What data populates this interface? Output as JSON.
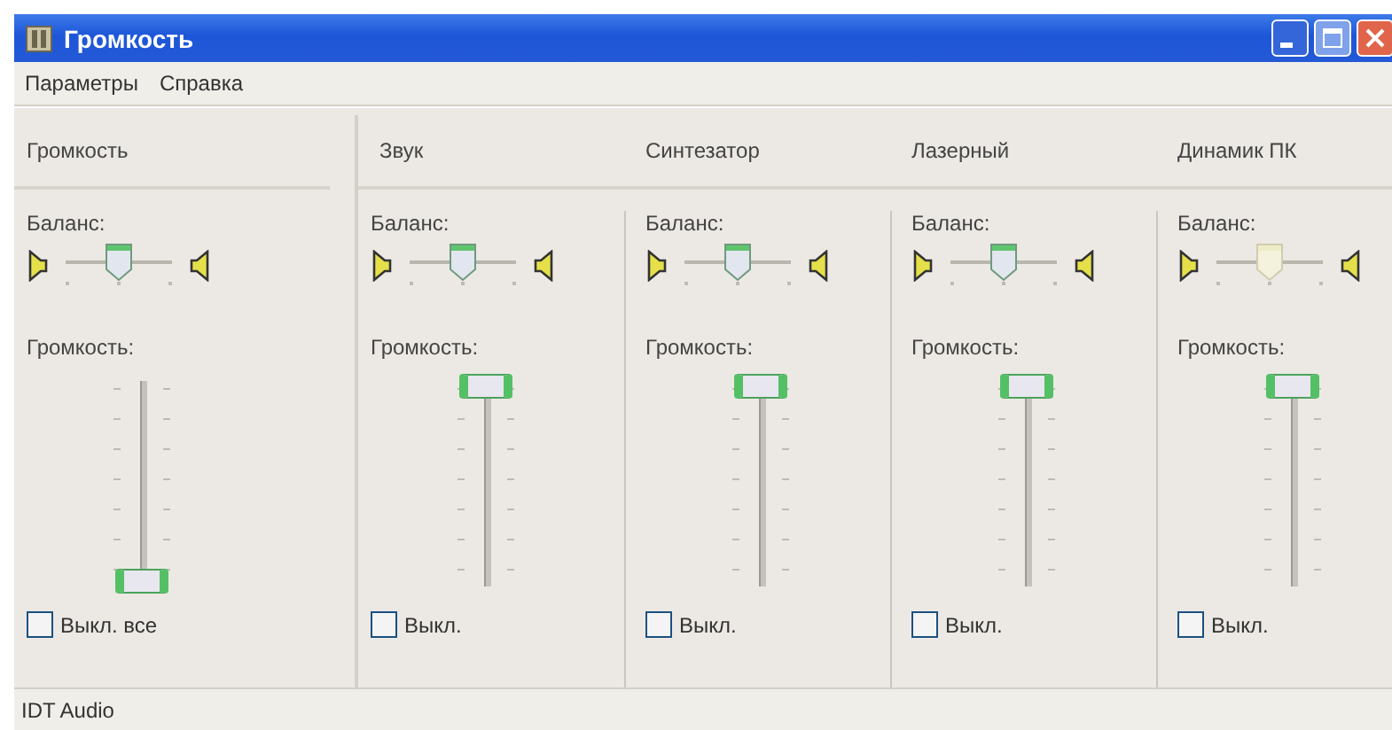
{
  "window": {
    "title": "Громкость"
  },
  "menu": [
    "Параметры",
    "Справка"
  ],
  "master": {
    "name": "Громкость",
    "balance_label": "Баланс:",
    "balance": {
      "level": 0.5,
      "disabled": false
    },
    "volume_label": "Громкость:",
    "volume": {
      "level": 0
    },
    "mute": {
      "label": "Выкл. все",
      "checked": false
    }
  },
  "channels": [
    {
      "name": "Звук",
      "balance_label": "Баланс:",
      "balance": {
        "level": 0.5,
        "disabled": false
      },
      "volume_label": "Громкость:",
      "volume": {
        "level": 1
      },
      "mute": {
        "label": "Выкл.",
        "checked": false
      }
    },
    {
      "name": "Синтезатор",
      "balance_label": "Баланс:",
      "balance": {
        "level": 0.5,
        "disabled": false
      },
      "volume_label": "Громкость:",
      "volume": {
        "level": 1
      },
      "mute": {
        "label": "Выкл.",
        "checked": false
      }
    },
    {
      "name": "Лазерный",
      "balance_label": "Баланс:",
      "balance": {
        "level": 0.5,
        "disabled": false
      },
      "volume_label": "Громкость:",
      "volume": {
        "level": 1
      },
      "mute": {
        "label": "Выкл.",
        "checked": false
      }
    },
    {
      "name": "Динамик ПК",
      "balance_label": "Баланс:",
      "balance": {
        "level": 0.5,
        "disabled": true
      },
      "volume_label": "Громкость:",
      "volume": {
        "level": 1
      },
      "mute": {
        "label": "Выкл.",
        "checked": false
      }
    }
  ],
  "status_bar": "IDT Audio"
}
